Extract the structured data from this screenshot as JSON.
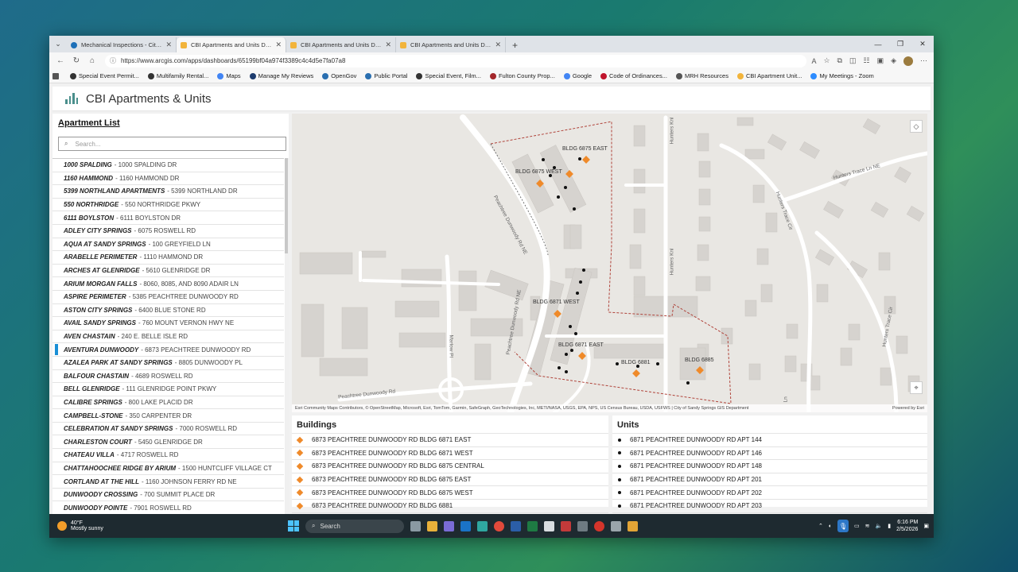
{
  "browser": {
    "tabs": [
      {
        "title": "Mechanical Inspections - City of",
        "favicon": "city-icon"
      },
      {
        "title": "CBI Apartments and Units Dashb",
        "favicon": "dashboard-icon",
        "active": true
      },
      {
        "title": "CBI Apartments and Units Dashb",
        "favicon": "dashboard-icon"
      },
      {
        "title": "CBI Apartments and Units Dashb",
        "favicon": "dashboard-icon"
      }
    ],
    "new_tab": "+",
    "url": "https://www.arcgis.com/apps/dashboards/65199bf04a974f3389c4c4d5e7fa07a8",
    "bookmarks": [
      {
        "label": "Special Event Permit...",
        "color": "#333333"
      },
      {
        "label": "Multifamily Rental...",
        "color": "#333333"
      },
      {
        "label": "Maps",
        "color": "#4285f4"
      },
      {
        "label": "Manage My Reviews",
        "color": "#1d3c6e"
      },
      {
        "label": "OpenGov",
        "color": "#2a6fb0"
      },
      {
        "label": "Public Portal",
        "color": "#2a6fb0"
      },
      {
        "label": "Special Event, Film...",
        "color": "#333333"
      },
      {
        "label": "Fulton County Prop...",
        "color": "#a3262a"
      },
      {
        "label": "Google",
        "color": "#4285f4"
      },
      {
        "label": "Code of Ordinances...",
        "color": "#c0142c"
      },
      {
        "label": "MRH Resources",
        "color": "#555555"
      },
      {
        "label": "CBI Apartment Unit...",
        "color": "#f2b43b"
      },
      {
        "label": "My Meetings - Zoom",
        "color": "#2d8cff"
      }
    ]
  },
  "app": {
    "title": "CBI Apartments & Units",
    "apartment_list": {
      "heading": "Apartment List",
      "search_placeholder": "Search...",
      "items": [
        {
          "name": "1000 SPALDING",
          "address": "- 1000 SPALDING DR"
        },
        {
          "name": "1160 HAMMOND",
          "address": "- 1160 HAMMOND DR"
        },
        {
          "name": "5399 NORTHLAND APARTMENTS",
          "address": "- 5399 NORTHLAND DR"
        },
        {
          "name": "550 NORTHRIDGE",
          "address": "- 550 NORTHRIDGE PKWY"
        },
        {
          "name": "6111 BOYLSTON",
          "address": "- 6111 BOYLSTON DR"
        },
        {
          "name": "ADLEY CITY SPRINGS",
          "address": "- 6075 ROSWELL RD"
        },
        {
          "name": "AQUA AT SANDY SPRINGS",
          "address": "- 100 GREYFIELD LN"
        },
        {
          "name": "ARABELLE PERIMETER",
          "address": "- 1110 HAMMOND DR"
        },
        {
          "name": "ARCHES AT GLENRIDGE",
          "address": "- 5610 GLENRIDGE DR"
        },
        {
          "name": "ARIUM MORGAN FALLS",
          "address": "- 8060, 8085, AND 8090 ADAIR LN"
        },
        {
          "name": "ASPIRE PERIMETER",
          "address": "- 5385 PEACHTREE DUNWOODY RD"
        },
        {
          "name": "ASTON CITY SPRINGS",
          "address": "- 6400 BLUE STONE RD"
        },
        {
          "name": "AVAIL SANDY SPRINGS",
          "address": "- 760 MOUNT VERNON HWY NE"
        },
        {
          "name": "AVEN CHASTAIN",
          "address": "- 240 E. BELLE ISLE RD"
        },
        {
          "name": "AVENTURA DUNWOODY",
          "address": "- 6873 PEACHTREE DUNWOODY RD",
          "selected": true
        },
        {
          "name": "AZALEA PARK AT SANDY SPRINGS",
          "address": "- 8805 DUNWOODY PL"
        },
        {
          "name": "BALFOUR CHASTAIN",
          "address": "- 4689 ROSWELL RD"
        },
        {
          "name": "BELL GLENRIDGE",
          "address": "- 111 GLENRIDGE POINT PKWY"
        },
        {
          "name": "CALIBRE SPRINGS",
          "address": "- 800 LAKE PLACID DR"
        },
        {
          "name": "CAMPBELL-STONE",
          "address": "- 350 CARPENTER DR"
        },
        {
          "name": "CELEBRATION AT SANDY SPRINGS",
          "address": "- 7000 ROSWELL RD"
        },
        {
          "name": "CHARLESTON COURT",
          "address": "- 5450 GLENRIDGE DR"
        },
        {
          "name": "CHATEAU VILLA",
          "address": "- 4717 ROSWELL RD"
        },
        {
          "name": "CHATTAHOOCHEE RIDGE BY ARIUM",
          "address": "- 1500 HUNTCLIFF VILLAGE CT"
        },
        {
          "name": "CORTLAND AT THE HILL",
          "address": "- 1160 JOHNSON FERRY RD NE"
        },
        {
          "name": "DUNWOODY CROSSING",
          "address": "- 700 SUMMIT PLACE DR"
        },
        {
          "name": "DUNWOODY POINTE",
          "address": "- 7901 ROSWELL RD"
        }
      ]
    },
    "map": {
      "labels": {
        "bldg_6875_east": "BLDG 6875 EAST",
        "bldg_6875_west": "BLDG 6875 WEST",
        "bldg_6871_west": "BLDG 6871 WEST",
        "bldg_6871_east": "BLDG 6871 EAST",
        "bldg_6881": "BLDG 6881",
        "bldg_6885": "BLDG 6885"
      },
      "roads": {
        "peachtree_dunwoody_1": "Peachtree Dunwoody Rd NE",
        "peachtree_dunwoody_2": "Peachtree Dunwoody Rd NE",
        "peachtree_dunwoody_3": "Peachtree Dunwoody Rd",
        "hunters_knl_1": "Hunters Knl",
        "hunters_knl_2": "Hunters Knl",
        "hunters_trace_ln": "Hunters Trace Ln NE",
        "hunters_trace_cir": "Hunters Trace Cir",
        "hunters_trace_cir_2": "Hunters Trace Cir",
        "marlow_pl": "Marlow Pl",
        "marlow_ln": "Ln"
      },
      "attribution": "Esri Community Maps Contributors, © OpenStreetMap, Microsoft, Esri, TomTom, Garmin, SafeGraph, GeoTechnologies, Inc, METI/NASA, USGS, EPA, NPS, US Census Bureau, USDA, USFWS | City of Sandy Springs GIS Department",
      "powered_by": "Powered by Esri",
      "colors": {
        "building_marker": "#ef8a2a",
        "unit_marker": "#111111",
        "boundary": "#b0433a"
      }
    },
    "buildings": {
      "heading": "Buildings",
      "items": [
        "6873 PEACHTREE DUNWOODY RD BLDG 6871 EAST",
        "6873 PEACHTREE DUNWOODY RD BLDG 6871 WEST",
        "6873 PEACHTREE DUNWOODY RD BLDG 6875 CENTRAL",
        "6873 PEACHTREE DUNWOODY RD BLDG 6875 EAST",
        "6873 PEACHTREE DUNWOODY RD BLDG 6875 WEST",
        "6873 PEACHTREE DUNWOODY RD BLDG 6881"
      ]
    },
    "units": {
      "heading": "Units",
      "items": [
        "6871 PEACHTREE DUNWOODY RD APT 144",
        "6871 PEACHTREE DUNWOODY RD APT 146",
        "6871 PEACHTREE DUNWOODY RD APT 148",
        "6871 PEACHTREE DUNWOODY RD APT 201",
        "6871 PEACHTREE DUNWOODY RD APT 202",
        "6871 PEACHTREE DUNWOODY RD APT 203"
      ]
    }
  },
  "taskbar": {
    "temperature": "40°F",
    "weather": "Mostly sunny",
    "search_placeholder": "Search",
    "time": "6:16 PM",
    "date": "2/5/2026"
  }
}
